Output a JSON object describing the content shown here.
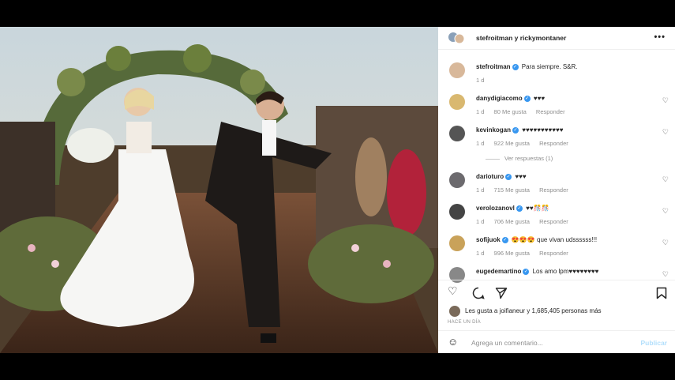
{
  "post": {
    "header_names": "stefroitman y rickymontaner",
    "more_label": "•••"
  },
  "caption": {
    "user": "stefroitman",
    "text": "Para siempre. S&R.",
    "time": "1 d"
  },
  "comments": [
    {
      "user": "danydigiacomo",
      "text": "♥♥♥",
      "time": "1 d",
      "likes": "80 Me gusta",
      "reply": "Responder"
    },
    {
      "user": "kevinkogan",
      "text": "♥♥♥♥♥♥♥♥♥♥♥",
      "time": "1 d",
      "likes": "922 Me gusta",
      "reply": "Responder",
      "view_replies": "Ver respuestas (1)"
    },
    {
      "user": "darioturo",
      "text": "♥♥♥",
      "time": "1 d",
      "likes": "715 Me gusta",
      "reply": "Responder"
    },
    {
      "user": "verolozanovl",
      "text": "♥♥🎊🎊",
      "time": "1 d",
      "likes": "706 Me gusta",
      "reply": "Responder"
    },
    {
      "user": "sofijuok",
      "text": "😍😍😍 que vivan udssssss!!!",
      "time": "1 d",
      "likes": "996 Me gusta",
      "reply": "Responder"
    },
    {
      "user": "eugedemartino",
      "text": "Los amo lpm♥♥♥♥♥♥♥♥",
      "time": "",
      "likes": "",
      "reply": ""
    }
  ],
  "likes_line": "Les gusta a joifianeur y 1,685,405 personas más",
  "posted_ago": "HACE UN DÍA",
  "comment_box": {
    "placeholder": "Agrega un comentario...",
    "publish": "Publicar"
  },
  "colors": {
    "verified": "#3897f0",
    "muted": "#8e8e8e",
    "publish_disabled": "#b2dffc"
  }
}
